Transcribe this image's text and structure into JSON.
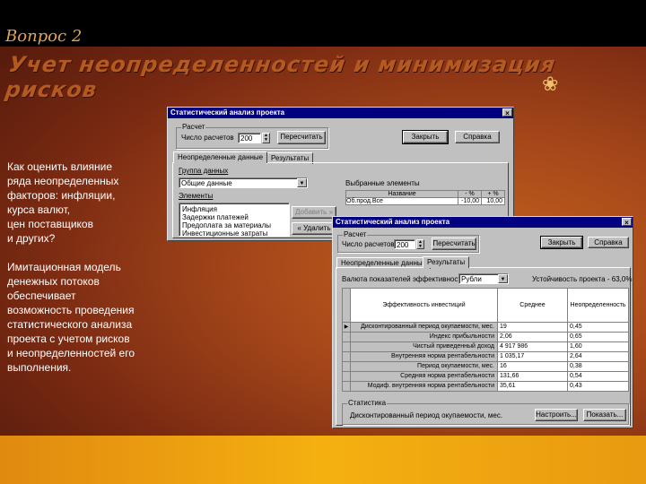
{
  "slide": {
    "question_label": "Вопрос 2",
    "title": "Учет неопределенностей и минимизация рисков",
    "deco_glyph": "❀",
    "left_paragraphs": [
      "Как оценить влияние\nряда неопределенных\nфакторов: инфляции,\nкурса валют,\nцен поставщиков\nи других?",
      "Имитационная модель\nденежных потоков\nобеспечивает\nвозможность проведения\nстатистического анализа\nпроекта с учетом рисков\nи неопределенностей его\nвыполнения."
    ]
  },
  "dialog1": {
    "title": "Статистический анализ проекта",
    "close_glyph": "×",
    "calc_group": "Расчет",
    "calc_count_label": "Число расчетов",
    "calc_count_value": "200",
    "recalc_button": "Пересчитать",
    "close_button": "Закрыть",
    "help_button": "Справка",
    "tabs": [
      "Неопределенные данные",
      "Результаты"
    ],
    "data_group_label": "Группа данных",
    "data_group_value": "Общие данные",
    "elements_label": "Элементы",
    "elements": [
      "Инфляция",
      "Задержки платежей",
      "Предоплата за материалы",
      "Инвестиционные затраты"
    ],
    "add_button": "Добавить »",
    "remove_button": "« Удалить",
    "selected_label": "Выбранные элементы",
    "selected_headers": [
      "Название",
      "- %",
      "+ %"
    ],
    "selected_rows": [
      {
        "name": "Об.прод.Все",
        "minus": "-10,00",
        "plus": "10,00"
      }
    ]
  },
  "dialog2": {
    "title": "Статистический анализ проекта",
    "close_glyph": "×",
    "calc_group": "Расчет",
    "calc_count_label": "Число расчетов",
    "calc_count_value": "200",
    "recalc_button": "Пересчитать",
    "close_button": "Закрыть",
    "help_button": "Справка",
    "tabs": [
      "Неопределенные данные",
      "Результаты"
    ],
    "currency_label": "Валюта показателей эффективности:",
    "currency_value": "Рубли",
    "stability_label": "Устойчивость проекта -",
    "stability_value": "63,0%",
    "table_headers": [
      "Эффективность инвестиций",
      "Среднее",
      "Неопределенность"
    ],
    "table_rows": [
      {
        "name": "Дисконтированный период окупаемости, мес.",
        "mean": "19",
        "unc": "0,45",
        "selected": true
      },
      {
        "name": "Индекс прибыльности",
        "mean": "2,06",
        "unc": "0,65",
        "selected": false
      },
      {
        "name": "Чистый приведенный доход",
        "mean": "4 917 986",
        "unc": "1,60",
        "selected": false
      },
      {
        "name": "Внутренняя норма рентабельности",
        "mean": "1 035,17",
        "unc": "2,64",
        "selected": false
      },
      {
        "name": "Период окупаемости, мес.",
        "mean": "16",
        "unc": "0,38",
        "selected": false
      },
      {
        "name": "Средняя норма рентабельности",
        "mean": "131,66",
        "unc": "0,54",
        "selected": false
      },
      {
        "name": "Модиф. внутренняя норма рентабельности",
        "mean": "35,61",
        "unc": "0,43",
        "selected": false
      }
    ],
    "selected_marker": "▶",
    "stats_group": "Статистика",
    "stats_text": "Дисконтированный период окупаемости, мес.",
    "setup_button": "Настроить...",
    "show_button": "Показать..."
  }
}
